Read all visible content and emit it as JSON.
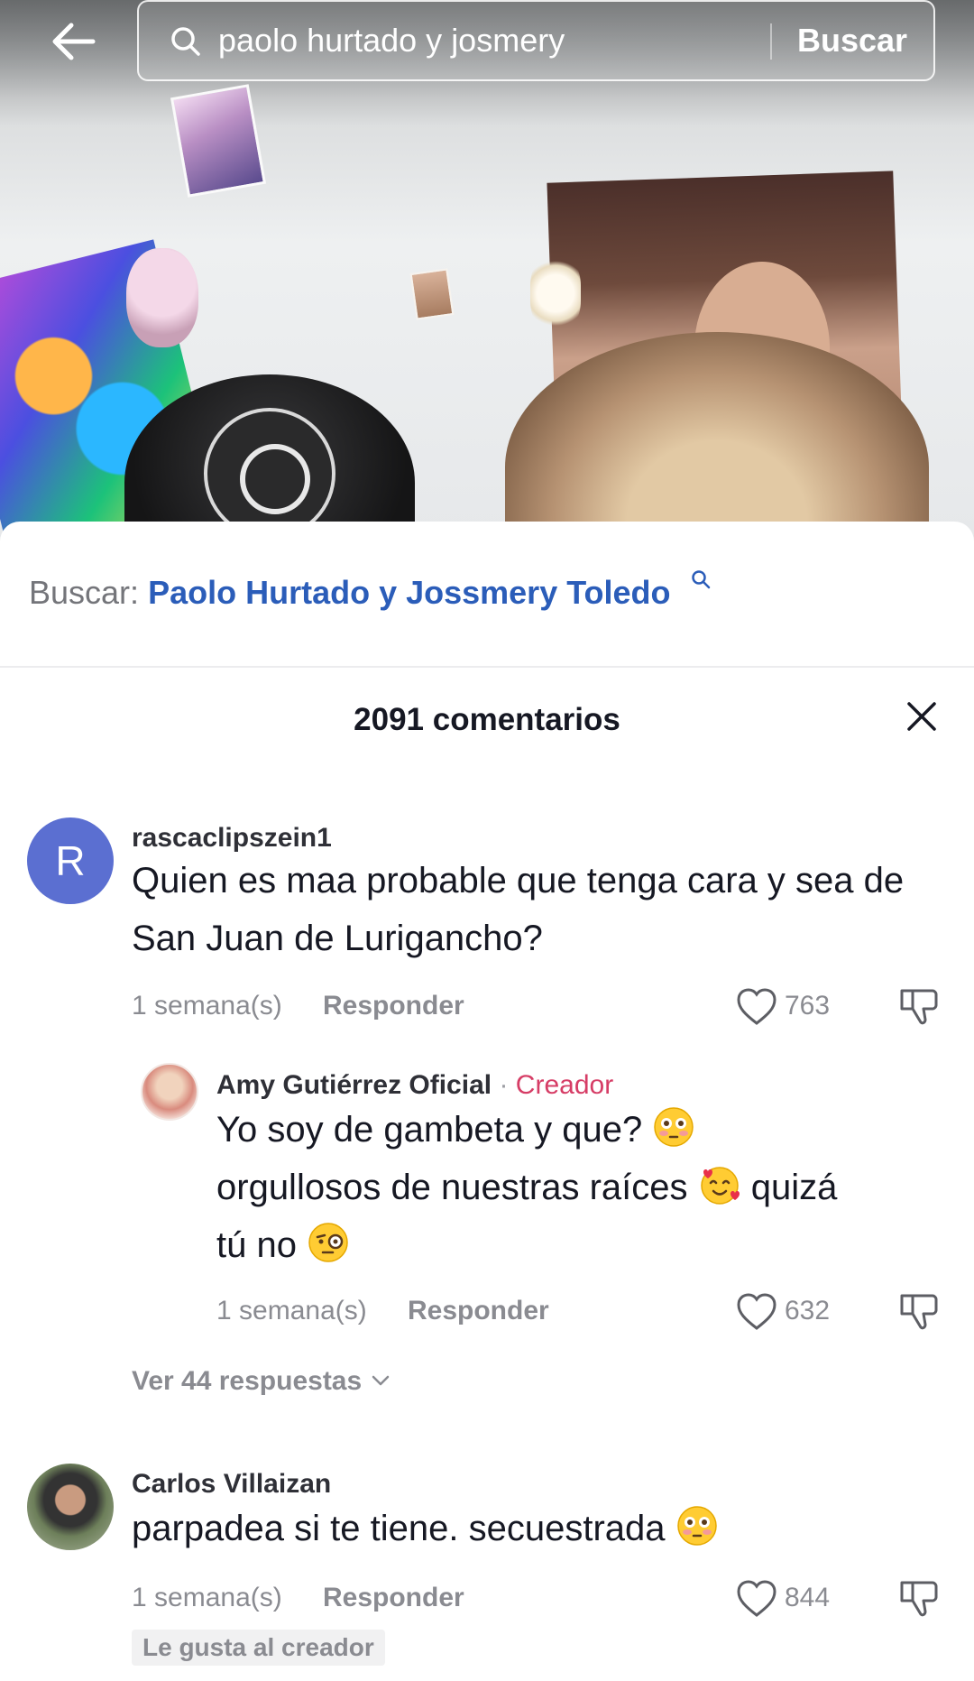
{
  "search": {
    "query": "paolo hurtado y josmery",
    "submit_label": "Buscar"
  },
  "related_search": {
    "prefix": "Buscar:",
    "term": "Paolo Hurtado y Jossmery Toledo"
  },
  "comments_panel": {
    "count_label": "2091 comentarios",
    "comments": [
      {
        "avatar_letter": "R",
        "username": "rascaclipszein1",
        "text": "Quien es maa probable que tenga cara y sea de San Juan de Lurigancho?",
        "time": "1 semana(s)",
        "reply_label": "Responder",
        "likes": "763"
      },
      {
        "username": "Carlos Villaizan",
        "text": "parpadea si te tiene. secuestrada",
        "time": "1 semana(s)",
        "reply_label": "Responder",
        "likes": "844",
        "badge": "Le gusta al creador"
      }
    ],
    "creator_reply": {
      "username": "Amy Gutiérrez Oficial",
      "separator": "·",
      "creator_label": "Creador",
      "text_part1": "Yo soy de gambeta y que?",
      "text_part2": "orgullosos de nuestras raíces",
      "text_part3": "quizá",
      "text_part4": "tú no",
      "time": "1 semana(s)",
      "reply_label": "Responder",
      "likes": "632"
    },
    "view_replies_label": "Ver 44 respuestas"
  },
  "colors": {
    "accent_link": "#2b5db9",
    "creator": "#d63d66",
    "avatar_r": "#5b6fd1",
    "muted": "#8a8b91"
  },
  "icons": [
    "back-arrow-icon",
    "search-icon",
    "close-icon",
    "heart-icon",
    "dislike-icon",
    "chevron-down-icon",
    "flushed-emoji-icon",
    "smiling-hearts-emoji-icon",
    "monocle-emoji-icon"
  ]
}
